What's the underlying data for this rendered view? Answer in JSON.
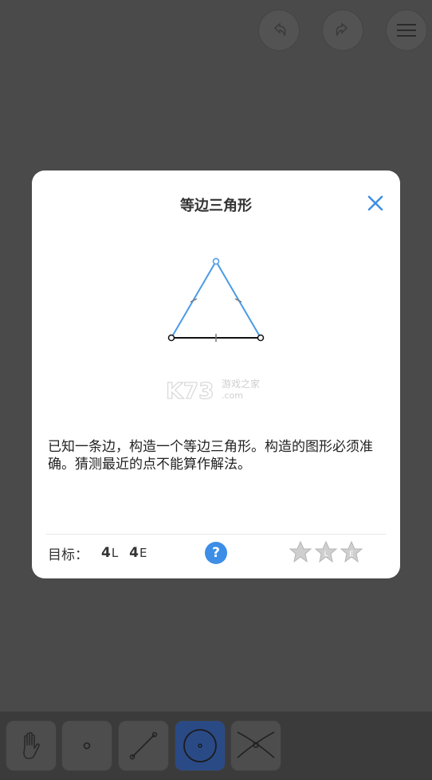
{
  "topbar": {
    "undo_icon": "undo-arrow-icon",
    "redo_icon": "redo-arrow-icon",
    "menu_icon": "hamburger-menu-icon"
  },
  "dialog": {
    "title": "等边三角形",
    "close_icon": "close-x-icon",
    "watermark": {
      "main": "K73",
      "sub": "游戏之家",
      "domain": ".com"
    },
    "description": "已知一条边，构造一个等边三角形。构造的图形必须准确。猜测最近的点不能算作解法。",
    "goal_label": "目标：",
    "goal_l_count": "4",
    "goal_l_unit": "L",
    "goal_e_count": "4",
    "goal_e_unit": "E",
    "help_label": "?",
    "stars": [
      {
        "letter": "",
        "icon": "star-icon"
      },
      {
        "letter": "L",
        "icon": "star-icon"
      },
      {
        "letter": "E",
        "icon": "star-icon"
      }
    ]
  },
  "toolbar": {
    "tools": [
      {
        "name": "move",
        "icon": "hand-icon"
      },
      {
        "name": "point",
        "icon": "point-icon"
      },
      {
        "name": "line",
        "icon": "line-icon"
      },
      {
        "name": "circle",
        "icon": "circle-icon",
        "active": true
      },
      {
        "name": "intersect",
        "icon": "intersect-icon"
      }
    ]
  },
  "colors": {
    "accent": "#3d8ee6",
    "triangle": "#4a9ae8",
    "overlay_bg": "#4a4a4a",
    "active_tool": "#2a4a86"
  }
}
